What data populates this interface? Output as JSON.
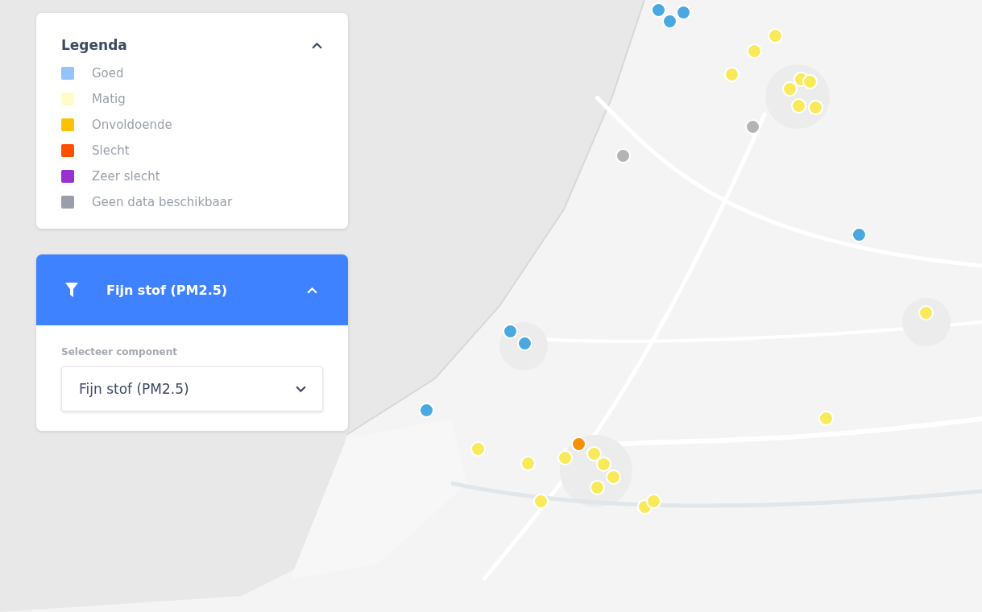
{
  "legend": {
    "title": "Legenda",
    "expanded": true,
    "items": [
      {
        "label": "Goed",
        "color": "#90c4fa"
      },
      {
        "label": "Matig",
        "color": "#fffcc8"
      },
      {
        "label": "Onvoldoende",
        "color": "#fcc200"
      },
      {
        "label": "Slecht",
        "color": "#ff5000"
      },
      {
        "label": "Zeer slecht",
        "color": "#9b30d0"
      },
      {
        "label": "Geen data beschikbaar",
        "color": "#999ea8"
      }
    ]
  },
  "filter": {
    "title": "Fijn stof (PM2.5)",
    "expanded": true,
    "field_label": "Selecteer component",
    "value": "Fijn stof (PM2.5)"
  },
  "markers": [
    {
      "color": "#4aa8e0"
    },
    {
      "color": "#4aa8e0"
    },
    {
      "color": "#4aa8e0"
    },
    {
      "color": "#4aa8e0"
    },
    {
      "color": "#4aa8e0"
    },
    {
      "color": "#4aa8e0"
    },
    {
      "color": "#4aa8e0"
    },
    {
      "color": "#f8ea5a"
    },
    {
      "color": "#f8ea5a"
    },
    {
      "color": "#f8ea5a"
    },
    {
      "color": "#f8ea5a"
    },
    {
      "color": "#f8ea5a"
    },
    {
      "color": "#f8ea5a"
    },
    {
      "color": "#f8ea5a"
    },
    {
      "color": "#f8ea5a"
    },
    {
      "color": "#f8ea5a"
    },
    {
      "color": "#f8ea5a"
    },
    {
      "color": "#f8ea5a"
    },
    {
      "color": "#f8ea5a"
    },
    {
      "color": "#f8ea5a"
    },
    {
      "color": "#f8ea5a"
    },
    {
      "color": "#f8ea5a"
    },
    {
      "color": "#f8ea5a"
    },
    {
      "color": "#f8ea5a"
    },
    {
      "color": "#f8ea5a"
    },
    {
      "color": "#f8ea5a"
    },
    {
      "color": "#f8ea5a"
    },
    {
      "color": "#f5900a"
    },
    {
      "color": "#b4b4b4"
    },
    {
      "color": "#b4b4b4"
    }
  ]
}
